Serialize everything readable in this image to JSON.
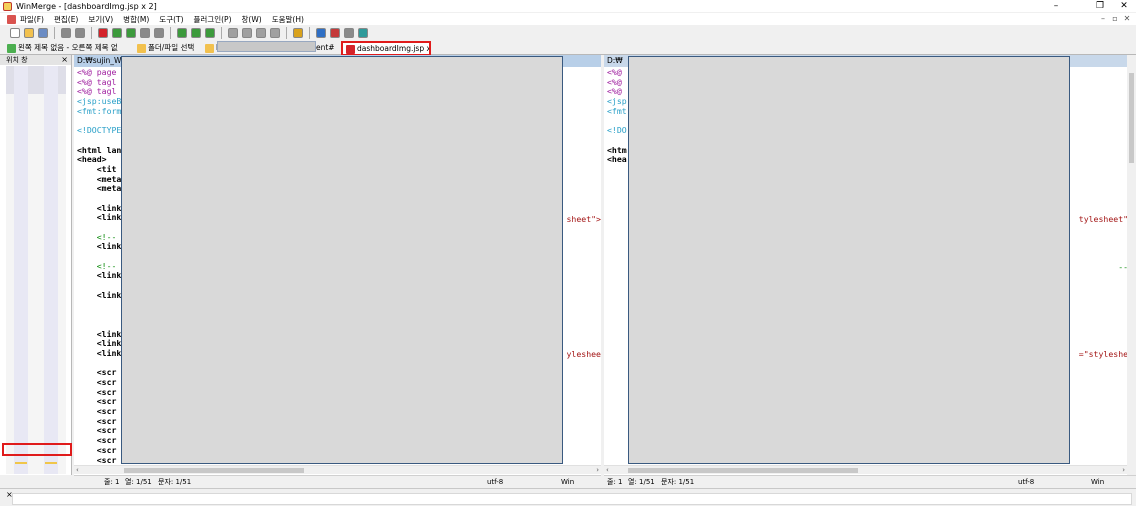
{
  "window": {
    "title": "WinMerge - [dashboardImg.jsp x 2]",
    "minimize": "–",
    "maximize": "❐",
    "close": "✕"
  },
  "menu": [
    "파일(F)",
    "편집(E)",
    "보기(V)",
    "병합(M)",
    "도구(T)",
    "플러그인(P)",
    "창(W)",
    "도움말(H)"
  ],
  "mdi_controls": [
    "–",
    "▫",
    "✕"
  ],
  "toolbar_icons": [
    {
      "name": "new-icon",
      "color": "#ffffff"
    },
    {
      "name": "open-icon",
      "color": "#f2c14e"
    },
    {
      "name": "save-icon",
      "color": "#6b8cc4"
    },
    {
      "sep": true
    },
    {
      "name": "undo-icon",
      "color": "#8a8a8a"
    },
    {
      "name": "redo-icon",
      "color": "#8a8a8a"
    },
    {
      "sep": true
    },
    {
      "name": "prev-diff-icon",
      "color": "#d4232a"
    },
    {
      "name": "next-diff-icon",
      "color": "#3c9a3c"
    },
    {
      "name": "first-diff-icon",
      "color": "#3c9a3c"
    },
    {
      "name": "last-diff-icon",
      "color": "#8a8a8a"
    },
    {
      "name": "current-diff-icon",
      "color": "#8a8a8a"
    },
    {
      "sep": true
    },
    {
      "name": "copy-right-icon",
      "color": "#3c9a3c"
    },
    {
      "name": "copy-left-icon",
      "color": "#3c9a3c"
    },
    {
      "name": "copy-all-icon",
      "color": "#3c9a3c"
    },
    {
      "sep": true
    },
    {
      "name": "move-right-icon",
      "color": "#a0a0a0"
    },
    {
      "name": "move-left-icon",
      "color": "#a0a0a0"
    },
    {
      "name": "merge-icon",
      "color": "#a0a0a0"
    },
    {
      "name": "auto-merge-icon",
      "color": "#a0a0a0"
    },
    {
      "sep": true
    },
    {
      "name": "options-icon",
      "color": "#d9a21c"
    },
    {
      "sep": true
    },
    {
      "name": "refresh-icon",
      "color": "#2f6fc4"
    },
    {
      "name": "compare-icon",
      "color": "#c43a3a"
    },
    {
      "name": "split-icon",
      "color": "#8a8a8a"
    },
    {
      "name": "settings-icon",
      "color": "#2f9a9a"
    }
  ],
  "tabs": [
    {
      "label": "왼쪽 제목 없음 - 오른쪽 제목 없",
      "icon": "compare-icon",
      "color": "#4caf50"
    },
    {
      "label": "폴더/파일 선택",
      "icon": "folder-icon",
      "color": "#f2c14e"
    },
    {
      "label": "k",
      "icon": "folder-icon",
      "color": "#f2c14e"
    },
    {
      "label": "ent#",
      "icon": "",
      "color": ""
    },
    {
      "label": "dashboardImg.jsp x 2",
      "icon": "file-compare-icon",
      "color": "#d4232a"
    }
  ],
  "location_pane": {
    "title": "위치 창",
    "close": "×"
  },
  "left_pane": {
    "path": "D:₩sujin_Wor",
    "status": {
      "line": "줄: 1",
      "col": "열: 1/51",
      "char": "문자: 1/51",
      "encoding": "utf-8",
      "eol": "Win"
    }
  },
  "right_pane": {
    "path": "D:₩",
    "status": {
      "line": "줄: 1",
      "col": "열: 1/51",
      "char": "문자: 1/51",
      "encoding": "utf-8",
      "eol": "Win"
    }
  },
  "left_code": [
    {
      "t": "<%@ page",
      "c": "pct"
    },
    {
      "t": "<%@ tagl",
      "c": "pct"
    },
    {
      "t": "<%@ tagl",
      "c": "pct"
    },
    {
      "t": "<jsp:useB",
      "c": "jsp"
    },
    {
      "t": "<fmt:form",
      "c": "jsp"
    },
    {
      "t": "",
      "c": ""
    },
    {
      "t": "<!DOCTYPE",
      "c": "jsp"
    },
    {
      "t": "",
      "c": ""
    },
    {
      "t": "<html lan",
      "c": "kw"
    },
    {
      "t": "<head>",
      "c": "kw"
    },
    {
      "t": "    <tit",
      "c": "kw"
    },
    {
      "t": "    <meta",
      "c": "kw"
    },
    {
      "t": "    <meta",
      "c": "kw"
    },
    {
      "t": "",
      "c": ""
    },
    {
      "t": "    <link",
      "c": "kw"
    },
    {
      "t": "    <link",
      "c": "kw"
    },
    {
      "t": "",
      "c": ""
    },
    {
      "t": "    <!--",
      "c": "cm"
    },
    {
      "t": "    <link",
      "c": "kw"
    },
    {
      "t": "",
      "c": ""
    },
    {
      "t": "    <!--",
      "c": "cm"
    },
    {
      "t": "    <link",
      "c": "kw"
    },
    {
      "t": "",
      "c": ""
    },
    {
      "t": "    <link",
      "c": "kw"
    },
    {
      "t": "",
      "c": ""
    },
    {
      "t": "",
      "c": ""
    },
    {
      "t": "",
      "c": ""
    },
    {
      "t": "    <link",
      "c": "kw"
    },
    {
      "t": "    <link",
      "c": "kw"
    },
    {
      "t": "    <link",
      "c": "kw"
    },
    {
      "t": "",
      "c": ""
    },
    {
      "t": "    <scr",
      "c": "kw"
    },
    {
      "t": "    <scr",
      "c": "kw"
    },
    {
      "t": "    <scr",
      "c": "kw"
    },
    {
      "t": "    <scr",
      "c": "kw"
    },
    {
      "t": "    <scr",
      "c": "kw"
    },
    {
      "t": "    <scr",
      "c": "kw"
    },
    {
      "t": "    <scr",
      "c": "kw"
    },
    {
      "t": "    <scr",
      "c": "kw"
    },
    {
      "t": "    <scr",
      "c": "kw"
    },
    {
      "t": "    <scr",
      "c": "kw"
    },
    {
      "t": "",
      "c": ""
    },
    {
      "t": "    <%--",
      "c": "pct"
    }
  ],
  "right_code": [
    {
      "t": "<%@",
      "c": "pct"
    },
    {
      "t": "<%@",
      "c": "pct"
    },
    {
      "t": "<%@",
      "c": "pct"
    },
    {
      "t": "<jsp",
      "c": "jsp"
    },
    {
      "t": "<fmt",
      "c": "jsp"
    },
    {
      "t": "",
      "c": ""
    },
    {
      "t": "<!DO",
      "c": "jsp"
    },
    {
      "t": "",
      "c": ""
    },
    {
      "t": "<htm",
      "c": "kw"
    },
    {
      "t": "<hea",
      "c": "kw"
    }
  ],
  "left_fragments": [
    {
      "text": "sheet\">",
      "row": 15
    },
    {
      "text": "yleshee",
      "row": 29
    }
  ],
  "right_fragments": [
    {
      "text": "tylesheet\">",
      "row": 15
    },
    {
      "text": "-->",
      "row": 20
    },
    {
      "text": "=\"styleshee",
      "row": 29
    }
  ]
}
